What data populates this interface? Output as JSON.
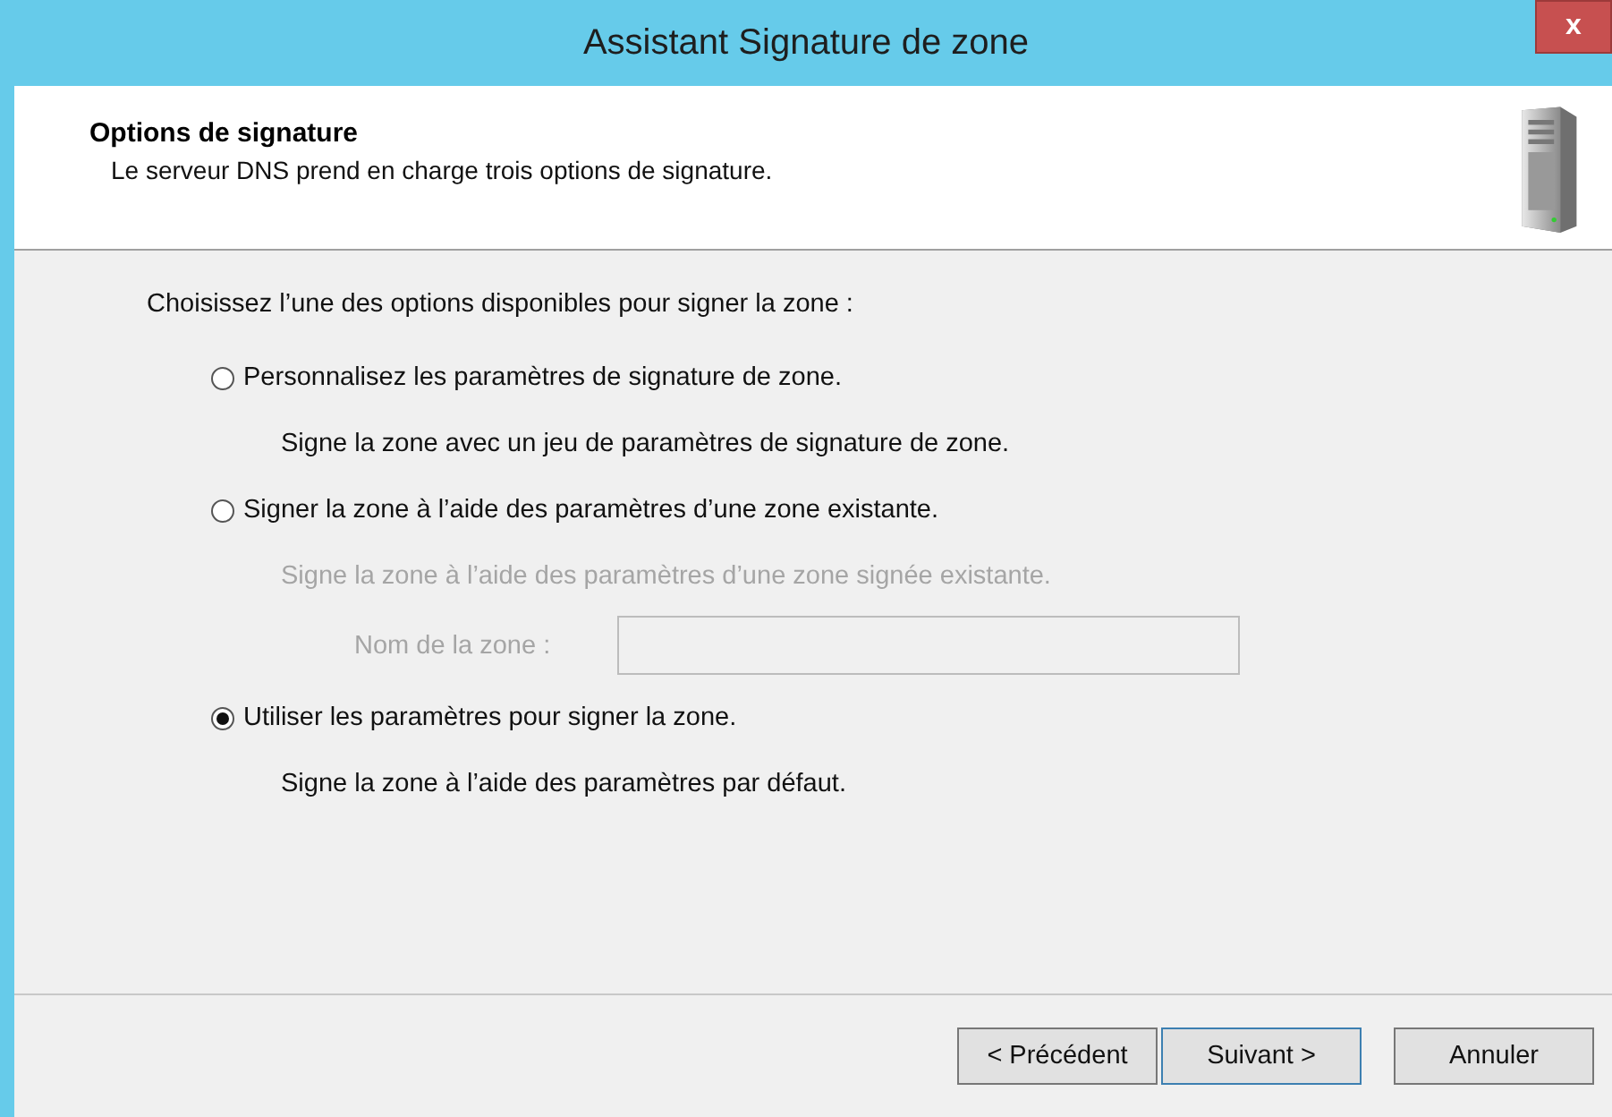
{
  "window": {
    "title": "Assistant Signature de zone",
    "close": "x"
  },
  "header": {
    "title": "Options de signature",
    "subtitle": "Le serveur DNS prend en charge trois options de signature."
  },
  "prompt": "Choisissez l’une des options disponibles pour signer la zone :",
  "options": [
    {
      "label": "Personnalisez les paramètres de signature de zone.",
      "selected": false,
      "description": "Signe la zone avec un jeu de paramètres de signature de zone.",
      "disabled": false
    },
    {
      "label": "Signer la zone à l’aide des paramètres d’une zone existante.",
      "selected": false,
      "description": "Signe la zone à l’aide des paramètres d’une zone signée existante.",
      "disabled": true,
      "field": {
        "label": "Nom de la zone :"
      }
    },
    {
      "label": "Utiliser les paramètres pour signer la zone.",
      "selected": true,
      "description": "Signe la zone à l’aide des paramètres par défaut.",
      "disabled": false
    }
  ],
  "buttons": [
    {
      "label": "< Précédent",
      "focused": false
    },
    {
      "label": "Suivant >",
      "focused": true
    },
    {
      "label": "Annuler",
      "focused": false
    }
  ]
}
